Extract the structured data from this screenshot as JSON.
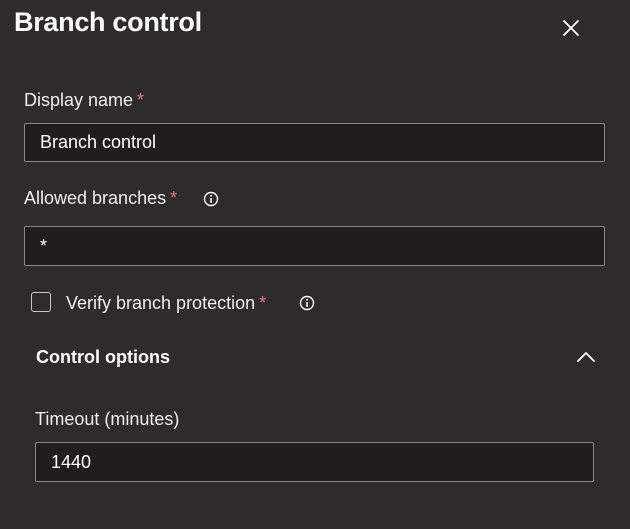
{
  "panel": {
    "title": "Branch control"
  },
  "display_name": {
    "label": "Display name",
    "required_mark": "*",
    "value": "Branch control"
  },
  "allowed_branches": {
    "label": "Allowed branches",
    "required_mark": "*",
    "value": "*"
  },
  "verify_protection": {
    "label": "Verify branch protection",
    "required_mark": "*",
    "checked": false
  },
  "control_options": {
    "title": "Control options",
    "timeout": {
      "label": "Timeout (minutes)",
      "value": "1440"
    }
  },
  "colors": {
    "background": "#2d2c2b",
    "input_background": "#1f1e1d",
    "input_border": "#8a8886",
    "required": "#f1707b",
    "text": "#e8e6e3"
  },
  "icons": [
    "close-icon",
    "info-icon",
    "chevron-up-icon"
  ]
}
